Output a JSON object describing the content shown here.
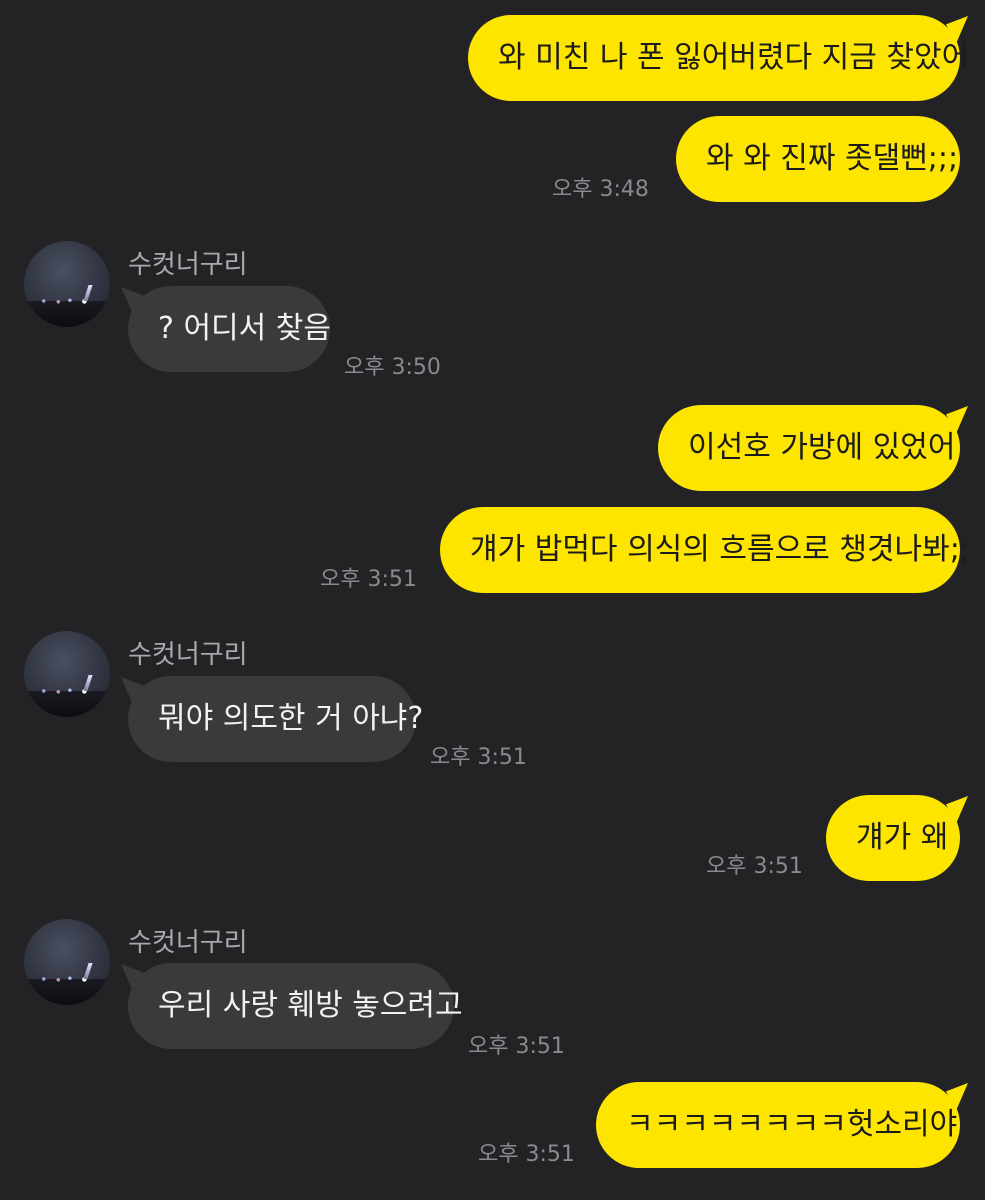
{
  "chat": {
    "sender_name": "수컷너구리",
    "messages": [
      {
        "text": "와 미친 나 폰 잃어버렸다 지금 찾았어"
      },
      {
        "text": "와 와 진짜 좃댈뻔;;;",
        "time": "오후 3:48"
      },
      {
        "text": "? 어디서 찾음",
        "time": "오후 3:50"
      },
      {
        "text": "이선호 가방에 있었어"
      },
      {
        "text": "걔가 밥먹다 의식의 흐름으로 챙겻나봐;;",
        "time": "오후 3:51"
      },
      {
        "text": "뭐야 의도한 거 아냐?",
        "time": "오후 3:51"
      },
      {
        "text": "걔가 왜",
        "time": "오후 3:51"
      },
      {
        "text": "우리 사랑 훼방 놓으려고",
        "time": "오후 3:51"
      },
      {
        "text": "ㅋㅋㅋㅋㅋㅋㅋㅋ헛소리야",
        "time": "오후 3:51"
      }
    ]
  },
  "colors": {
    "background": "#232325",
    "my_bubble": "#fee500",
    "their_bubble": "#3a3a3d"
  }
}
